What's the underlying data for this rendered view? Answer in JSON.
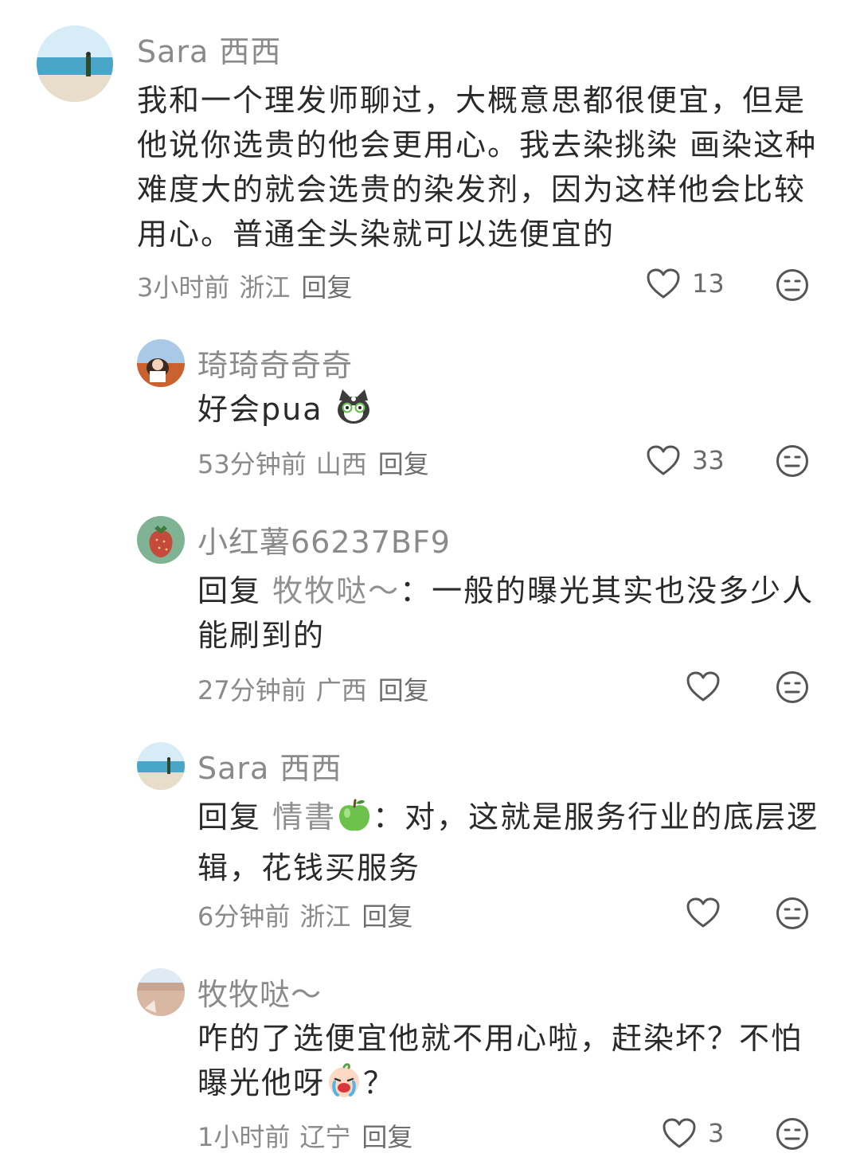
{
  "comments": [
    {
      "user": "Sara 西西",
      "text": "我和一个理发师聊过，大概意思都很便宜，但是他说你选贵的他会更用心。我去染挑染 画染这种难度大的就会选贵的染发剂，因为这样他会比较用心。普通全头染就可以选便宜的",
      "time": "3小时前",
      "location": "浙江",
      "reply": "回复",
      "likes": "13"
    },
    {
      "user": "琦琦奇奇奇",
      "text": "好会pua",
      "emoji_after": "cat-face-emoji",
      "time": "53分钟前",
      "location": "山西",
      "reply": "回复",
      "likes": "33"
    },
    {
      "user": "小红薯66237BF9",
      "reply_prefix": "回复",
      "reply_to": "牧牧哒～",
      "text": "：一般的曝光其实也没多少人能刷到的",
      "time": "27分钟前",
      "location": "广西",
      "reply": "回复",
      "likes": ""
    },
    {
      "user": "Sara 西西",
      "reply_prefix": "回复",
      "reply_to": "情書",
      "reply_to_emoji": "green-apple-emoji",
      "text": "：对，这就是服务行业的底层逻辑，花钱买服务",
      "time": "6分钟前",
      "location": "浙江",
      "reply": "回复",
      "likes": ""
    },
    {
      "user": "牧牧哒～",
      "text": "咋的了选便宜他就不用心啦，赶染坏？不怕曝光他呀",
      "text_end": "？",
      "emoji_inline": "crying-face-emoji",
      "time": "1小时前",
      "location": "辽宁",
      "reply": "回复",
      "likes": "3"
    }
  ],
  "colors": {
    "text": "#2a2a2a",
    "muted": "#8a8a8a",
    "icon": "#555555"
  }
}
